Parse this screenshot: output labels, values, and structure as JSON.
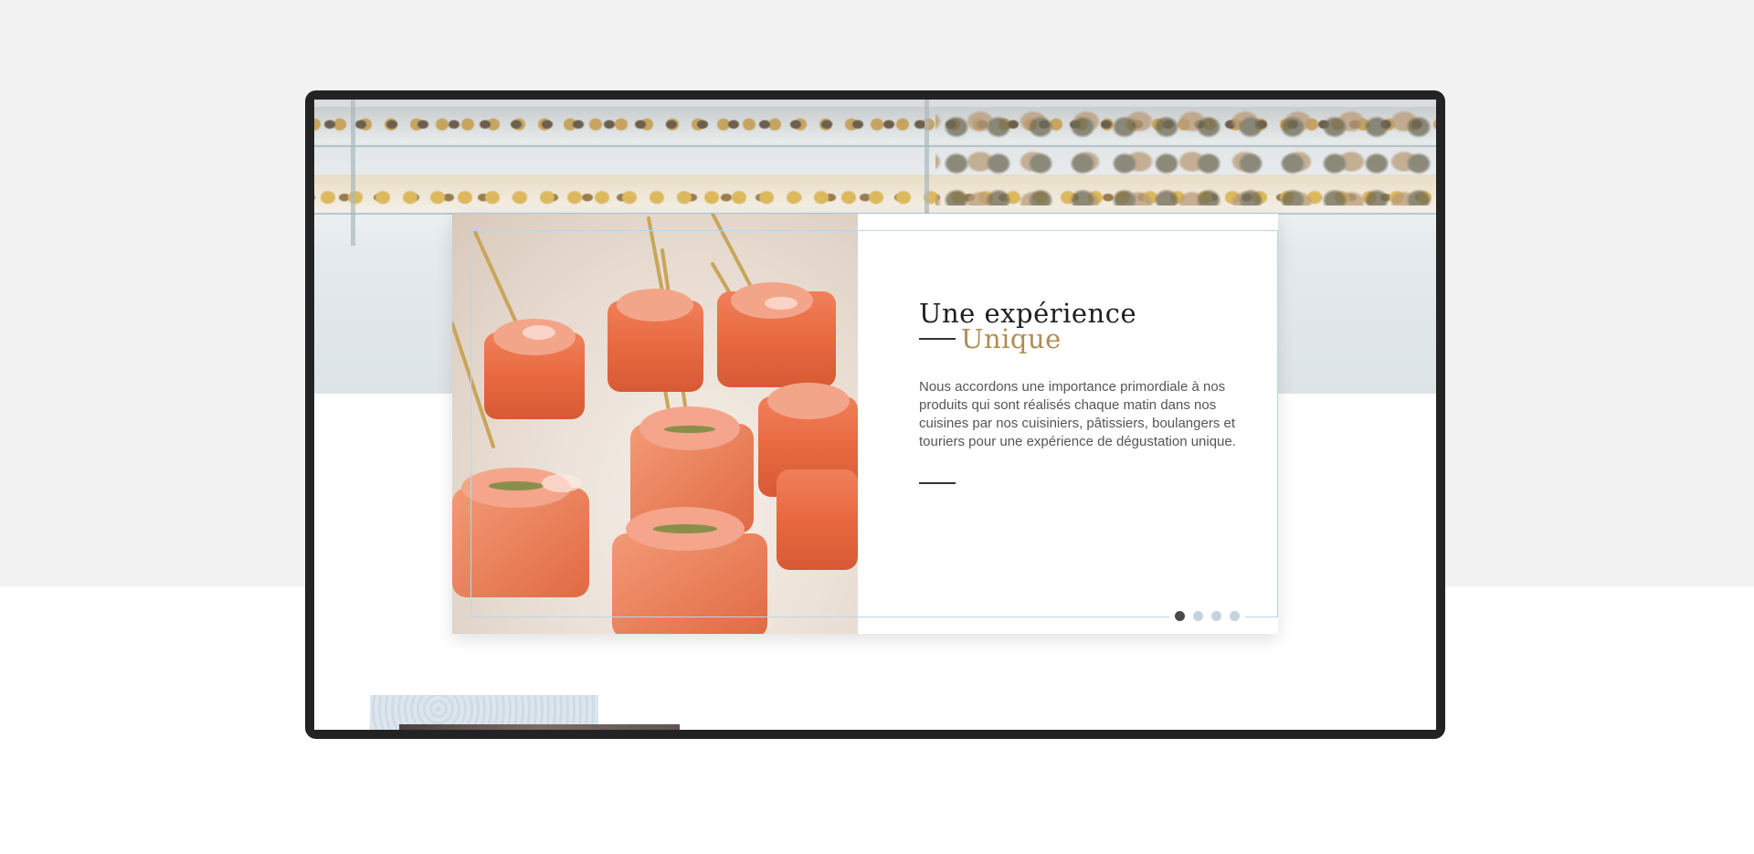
{
  "slide": {
    "title_line1": "Une expérience",
    "title_line2": "Unique",
    "description": "Nous accordons une importance primordiale à nos produits qui sont réalisés chaque matin dans nos cuisines par nos cuisiniers, pâtissiers, boulangers et touriers pour une expérience de dégustation unique.",
    "photo": "salmon-skewers-photo",
    "active_index": 1,
    "total": 4
  },
  "hero": {
    "photo": "bakery-display-case-photo"
  },
  "colors": {
    "accent_gold": "#b08d55",
    "frame_blue": "#b7d7ea",
    "dot_active": "#4a4a4a",
    "dot_inactive": "#c5d3de",
    "device_bezel": "#232323"
  }
}
